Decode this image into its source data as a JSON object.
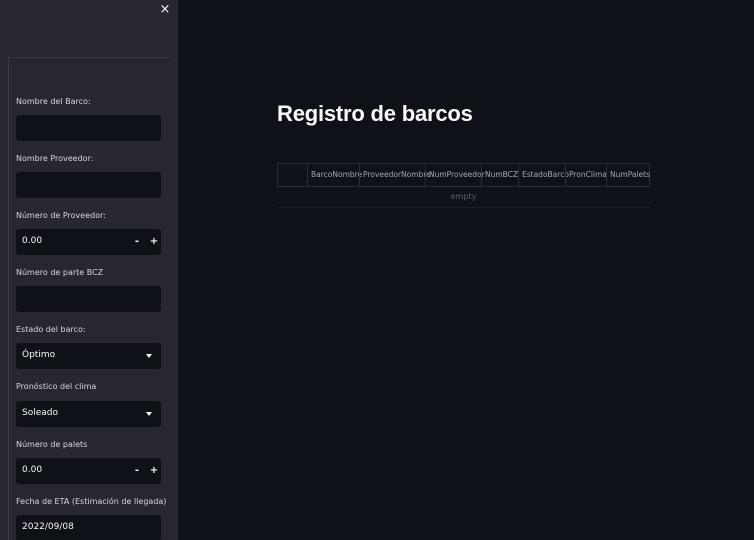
{
  "sidebar": {
    "close_glyph": "×",
    "fields": {
      "nombre_barco": {
        "label": "Nombre del Barco:",
        "value": ""
      },
      "nombre_proveedor": {
        "label": "Nombre Proveedor:",
        "value": ""
      },
      "numero_proveedor": {
        "label": "Número de Proveedor:",
        "value": "0.00",
        "minus": "-",
        "plus": "+"
      },
      "numero_parte_bcz": {
        "label": "Número de parte BCZ",
        "value": ""
      },
      "estado_barco": {
        "label": "Estado del barco:",
        "value": "Óptimo"
      },
      "pronostico_clima": {
        "label": "Pronóstico del clima",
        "value": "Soleado"
      },
      "numero_palets": {
        "label": "Número de palets",
        "value": "0.00",
        "minus": "-",
        "plus": "+"
      },
      "fecha_eta": {
        "label": "Fecha de ETA (Estimación de llegada)",
        "value": "2022/09/08"
      }
    }
  },
  "main": {
    "title": "Registro de barcos",
    "table": {
      "columns": [
        "BarcoNombre",
        "ProveedorNombre",
        "NumProveedor",
        "NumBCZ",
        "EstadoBarco",
        "PronClima",
        "NumPalets"
      ],
      "empty_text": "empty"
    }
  },
  "colors": {
    "sidebar_bg": "#262730",
    "main_bg": "#0e1117",
    "input_bg": "#0e1117",
    "text": "#fafafa"
  }
}
